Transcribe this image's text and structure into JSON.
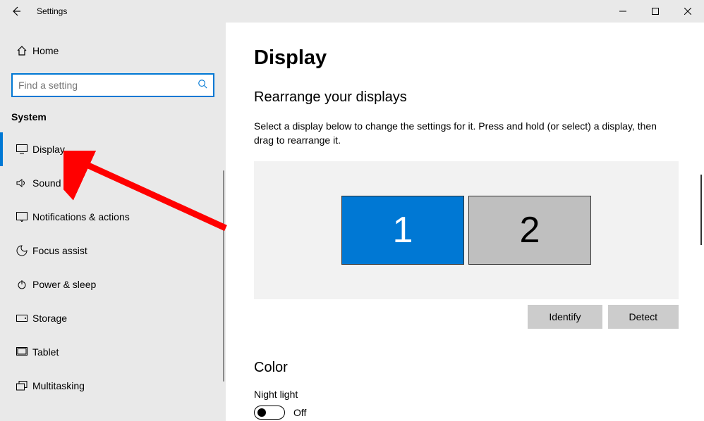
{
  "titlebar": {
    "title": "Settings"
  },
  "sidebar": {
    "home": "Home",
    "search_placeholder": "Find a setting",
    "section": "System",
    "items": [
      {
        "label": "Display",
        "icon": "display",
        "active": true
      },
      {
        "label": "Sound",
        "icon": "sound"
      },
      {
        "label": "Notifications & actions",
        "icon": "notifications"
      },
      {
        "label": "Focus assist",
        "icon": "focus"
      },
      {
        "label": "Power & sleep",
        "icon": "power"
      },
      {
        "label": "Storage",
        "icon": "storage"
      },
      {
        "label": "Tablet",
        "icon": "tablet"
      },
      {
        "label": "Multitasking",
        "icon": "multitasking"
      }
    ]
  },
  "main": {
    "page_title": "Display",
    "rearrange_title": "Rearrange your displays",
    "rearrange_text": "Select a display below to change the settings for it. Press and hold (or select) a display, then drag to rearrange it.",
    "monitors": {
      "m1": "1",
      "m2": "2"
    },
    "identify_btn": "Identify",
    "detect_btn": "Detect",
    "color_header": "Color",
    "night_light_label": "Night light",
    "toggle_state": "Off"
  }
}
